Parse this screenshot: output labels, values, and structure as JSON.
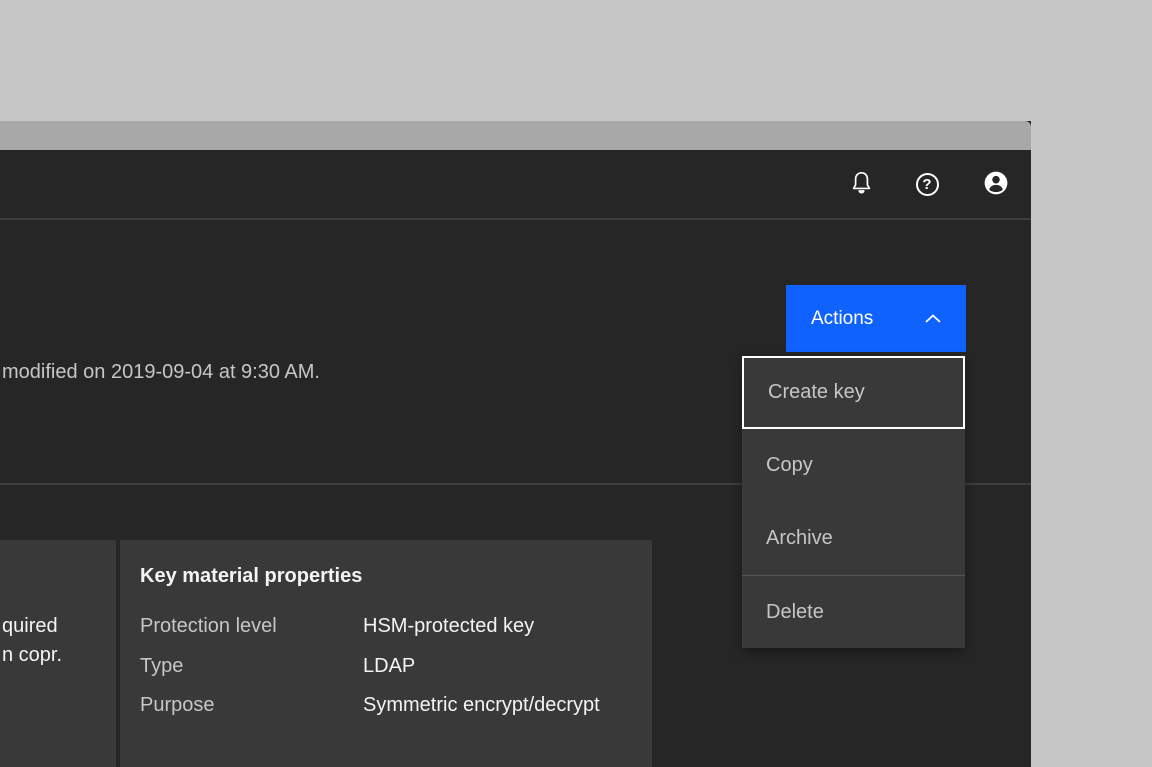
{
  "colors": {
    "canvas": "#c6c6c6",
    "titlebar": "#a8a8a8",
    "surface": "#262626",
    "layer": "#393939",
    "divider": "#3d3d3d",
    "accent_blue": "#0f62fe",
    "focus_outline": "#ffffff",
    "text_primary": "#f4f4f4",
    "text_secondary": "#c6c6c6"
  },
  "header": {
    "icons": [
      {
        "name": "notifications-bell"
      },
      {
        "name": "help",
        "glyph": "?"
      },
      {
        "name": "user-avatar"
      }
    ]
  },
  "content": {
    "status_text": "modified on 2019-09-04 at 9:30 AM."
  },
  "actions": {
    "button_label": "Actions",
    "menu_items": [
      {
        "label": "Create key",
        "focused": true
      },
      {
        "label": "Copy",
        "focused": false
      },
      {
        "label": "Archive",
        "focused": false
      },
      {
        "label": "Delete",
        "focused": false
      }
    ]
  },
  "left_panel": {
    "clipped_lines": [
      "quired",
      "n copr."
    ]
  },
  "properties_panel": {
    "title": "Key material properties",
    "rows": [
      {
        "label": "Protection level",
        "value": "HSM-protected key"
      },
      {
        "label": "Type",
        "value": "LDAP"
      },
      {
        "label": "Purpose",
        "value": "Symmetric encrypt/decrypt"
      }
    ]
  }
}
